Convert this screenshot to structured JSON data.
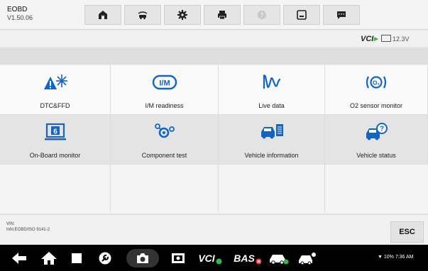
{
  "app": {
    "title": "EOBD",
    "version": "V1.50.06"
  },
  "toolbar": {
    "buttons": [
      "home-icon",
      "vehicle-swap-icon",
      "gear-icon",
      "printer-icon",
      "help-icon",
      "save-icon",
      "message-icon"
    ]
  },
  "status": {
    "vci_brand": "VCI",
    "battery_text": "12.3V"
  },
  "grid": {
    "items": [
      {
        "label": "DTC&FFD",
        "icon": "dtc-freeze-frame-icon"
      },
      {
        "label": "I/M readiness",
        "icon": "im-readiness-icon"
      },
      {
        "label": "Live data",
        "icon": "live-data-icon"
      },
      {
        "label": "O2 sensor monitor",
        "icon": "o2-sensor-icon"
      },
      {
        "label": "On-Board monitor",
        "icon": "onboard-monitor-icon"
      },
      {
        "label": "Component test",
        "icon": "component-test-icon"
      },
      {
        "label": "Vehicle information",
        "icon": "vehicle-info-icon"
      },
      {
        "label": "Vehicle status",
        "icon": "vehicle-status-icon"
      }
    ]
  },
  "footer": {
    "vin_label": "VIN:",
    "info": "Info:EOBD/ISO 9141-2",
    "esc_label": "ESC"
  },
  "navbar": {
    "vci_text": "VCI",
    "bas_text": "BAS",
    "system_status": "10% 7:36 AM"
  },
  "colors": {
    "accent_blue": "#1e6fe0",
    "accent_green": "#39b54a",
    "accent_red": "#e53935"
  }
}
